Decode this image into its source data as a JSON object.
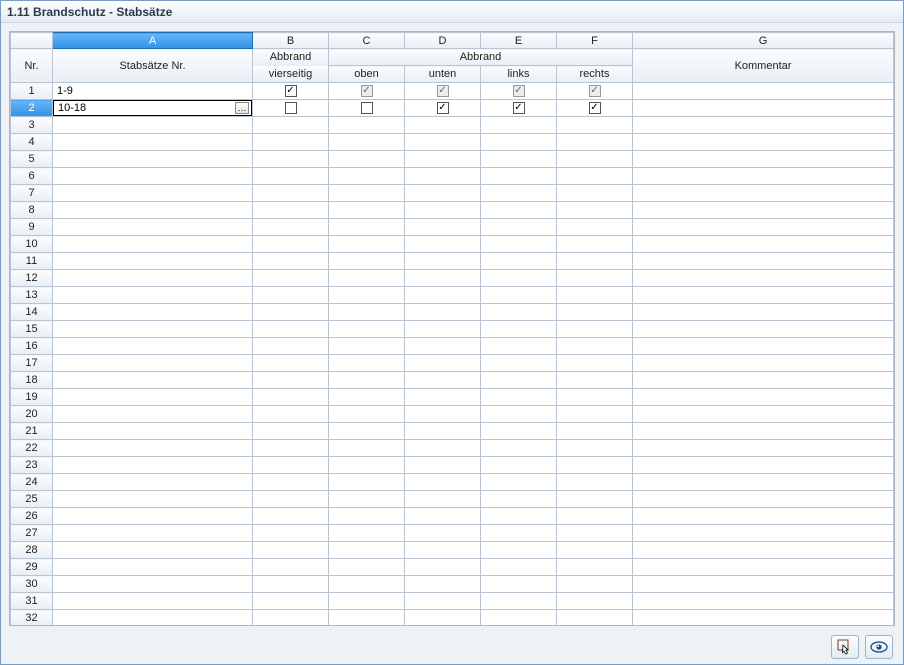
{
  "window": {
    "title": "1.11 Brandschutz - Stabsätze"
  },
  "columns": {
    "letters": {
      "a": "A",
      "b": "B",
      "c": "C",
      "d": "D",
      "e": "E",
      "f": "F",
      "g": "G"
    },
    "nr": "Nr.",
    "stabsaetze": "Stabsätze Nr.",
    "abbrand_vierseitig_1": "Abbrand",
    "abbrand_vierseitig_2": "vierseitig",
    "abbrand_group": "Abbrand",
    "oben": "oben",
    "unten": "unten",
    "links": "links",
    "rechts": "rechts",
    "kommentar": "Kommentar"
  },
  "rows": [
    {
      "nr": "1",
      "stabsaetze": "1-9",
      "vierseitig": {
        "checked": true,
        "enabled": true
      },
      "oben": {
        "checked": true,
        "enabled": false
      },
      "unten": {
        "checked": true,
        "enabled": false
      },
      "links": {
        "checked": true,
        "enabled": false
      },
      "rechts": {
        "checked": true,
        "enabled": false
      },
      "kommentar": ""
    },
    {
      "nr": "2",
      "stabsaetze": "10-18",
      "vierseitig": {
        "checked": false,
        "enabled": true
      },
      "oben": {
        "checked": false,
        "enabled": true
      },
      "unten": {
        "checked": true,
        "enabled": true
      },
      "links": {
        "checked": true,
        "enabled": true
      },
      "rechts": {
        "checked": true,
        "enabled": true
      },
      "kommentar": ""
    }
  ],
  "selected": {
    "row": 2,
    "col": "A"
  },
  "total_rows": 33,
  "buttons": {
    "pick": "pick",
    "view": "view"
  }
}
